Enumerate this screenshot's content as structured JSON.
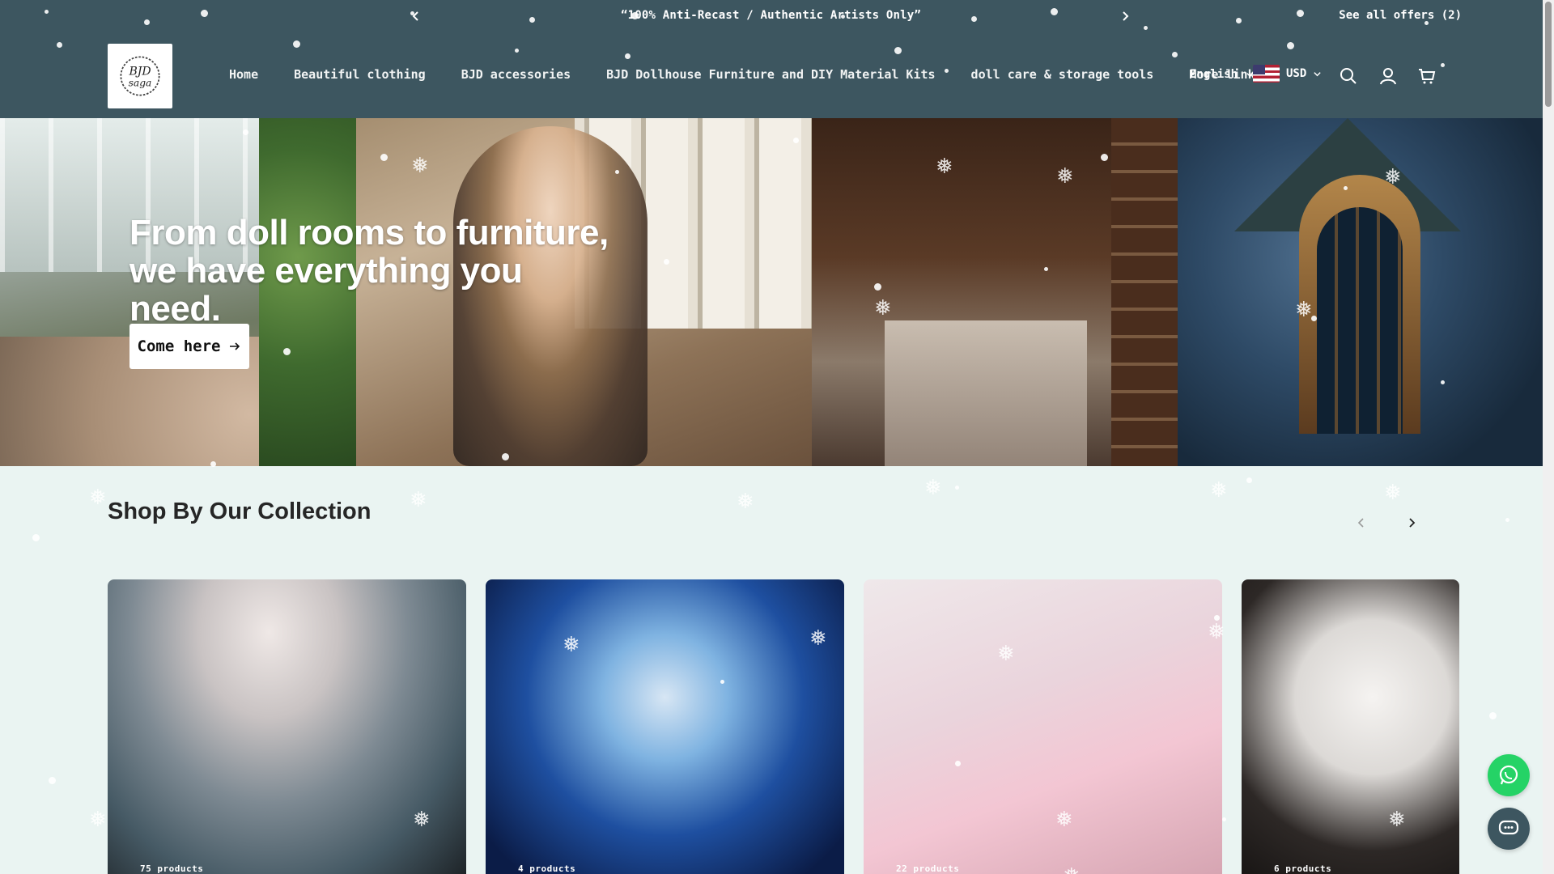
{
  "announcement": {
    "message": "“100% Anti-Recast / Authentic Artists Only”",
    "offers_label": "See all offers (2)"
  },
  "header": {
    "logo_text": "BJD saga",
    "nav": [
      "Home",
      "Beautiful clothing",
      "BJD accessories",
      "BJD Dollhouse Furniture and DIY Material Kits",
      "doll care & storage tools",
      "More links"
    ],
    "language": "English",
    "currency": "USD"
  },
  "hero": {
    "title": "From doll rooms to furniture, we have everything you need.",
    "cta_label": "Come here"
  },
  "collection": {
    "title": "Shop By Our Collection",
    "cards": [
      {
        "count": "75 products"
      },
      {
        "count": "4 products"
      },
      {
        "count": "22 products"
      },
      {
        "count": "6 products"
      }
    ]
  },
  "colors": {
    "header_bg": "#3d5660",
    "page_bg": "#eaf4f2",
    "whatsapp": "#25d366"
  },
  "icons": [
    "chevron-left-icon",
    "chevron-right-icon",
    "search-icon",
    "account-icon",
    "cart-icon",
    "whatsapp-icon",
    "chat-icon",
    "arrow-right-icon"
  ]
}
